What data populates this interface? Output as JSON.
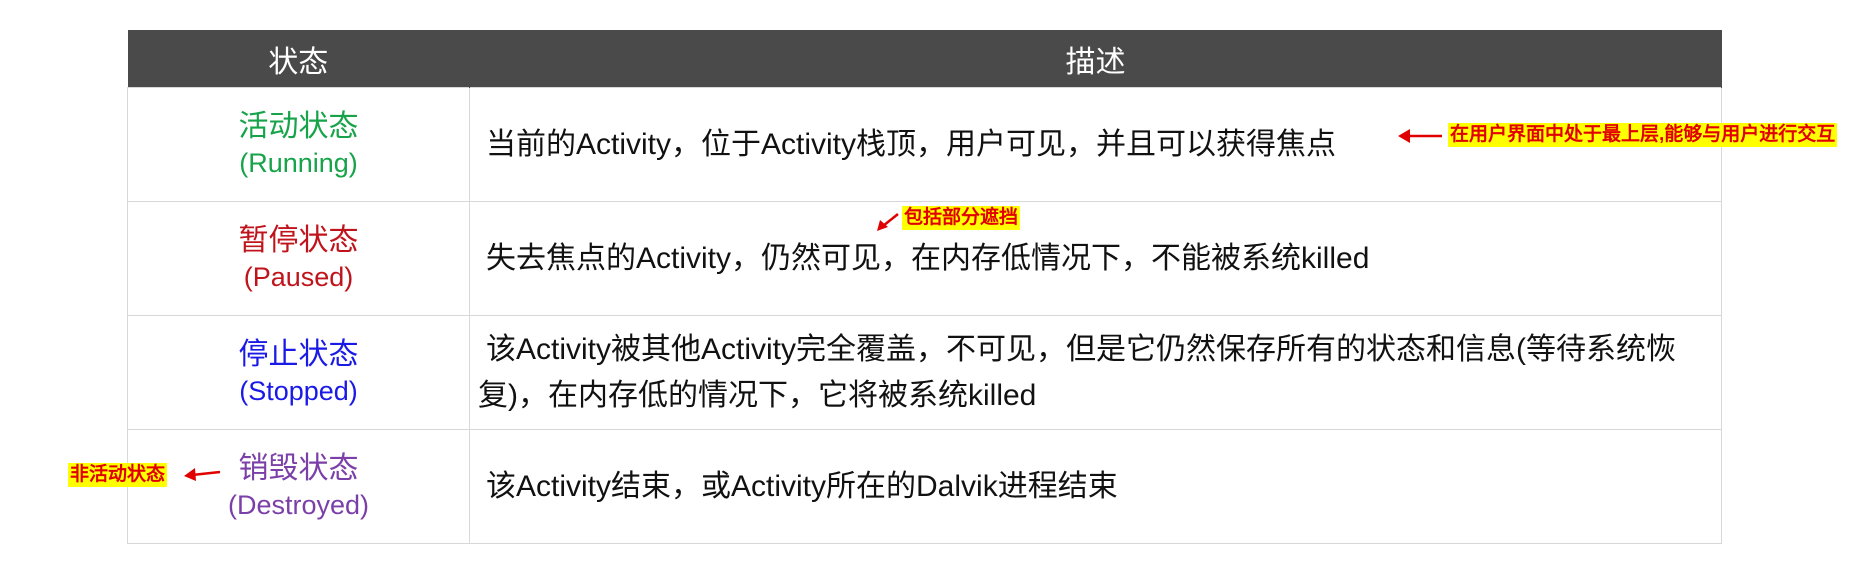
{
  "table": {
    "headers": [
      "状态",
      "描述"
    ],
    "rows": [
      {
        "state": "活动状态",
        "state_en": "(Running)",
        "color": "#17a34a",
        "description": "当前的Activity，位于Activity栈顶，用户可见，并且可以获得焦点"
      },
      {
        "state": "暂停状态",
        "state_en": "(Paused)",
        "color": "#c0141c",
        "description": "失去焦点的Activity，仍然可见，在内存低情况下，不能被系统killed"
      },
      {
        "state": "停止状态",
        "state_en": "(Stopped)",
        "color": "#1a1ae6",
        "description": "该Activity被其他Activity完全覆盖，不可见，但是它仍然保存所有的状态和信息(等待系统恢复)，在内存低的情况下，它将被系统killed"
      },
      {
        "state": "销毁状态",
        "state_en": "(Destroyed)",
        "color": "#7b3fa8",
        "description": "该Activity结束，或Activity所在的Dalvik进程结束"
      }
    ]
  },
  "annotations": {
    "running_note": "在用户界面中处于最上层,能够与用户进行交互",
    "paused_note": "包括部分遮挡",
    "destroyed_note": "非活动状态",
    "note_color": "#e00000",
    "note_bg": "#ffff00"
  }
}
